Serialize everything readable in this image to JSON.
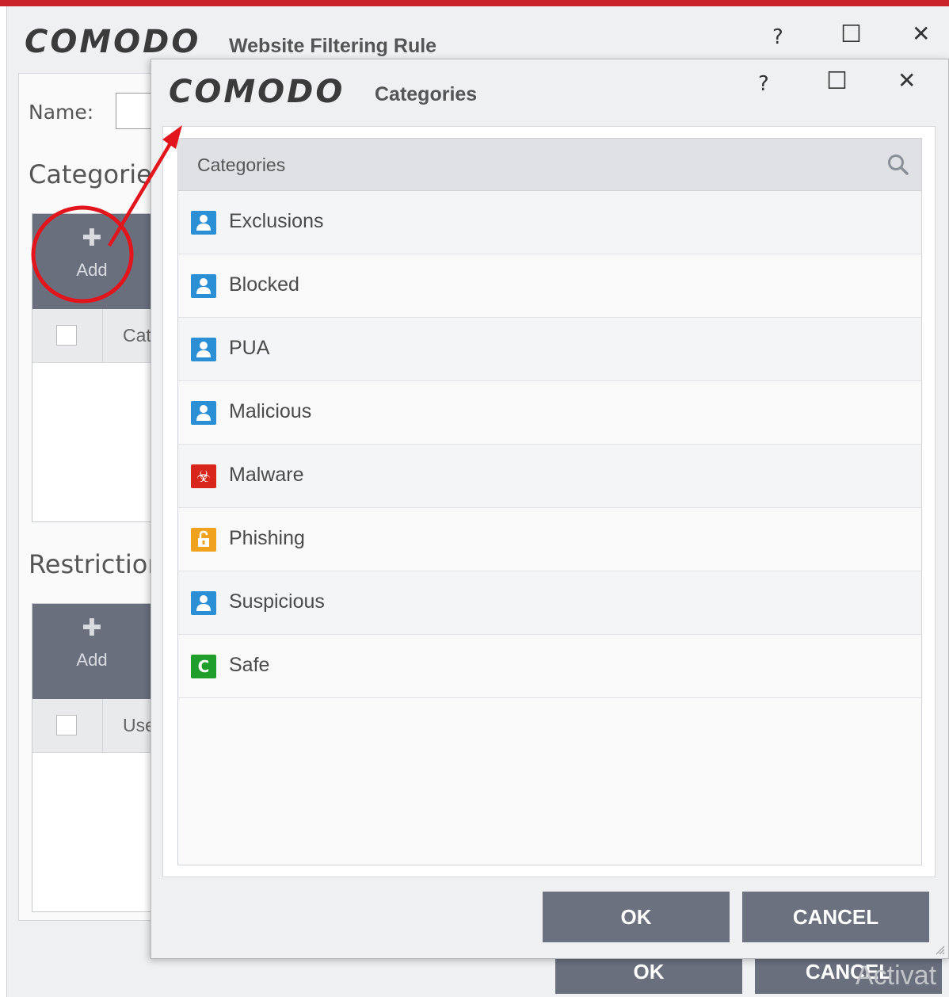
{
  "back_window": {
    "logo": "COMODO",
    "title": "Website Filtering Rule",
    "help": "?",
    "maximize": "☐",
    "close": "✕",
    "name_label": "Name:",
    "categories_heading": "Categories",
    "categories_add": "Add",
    "categories_column": "Cat",
    "restrictions_heading": "Restriction",
    "restrictions_add": "Add",
    "restrictions_column": "Use",
    "ok": "OK",
    "cancel": "CANCEL",
    "watermark": "Activat"
  },
  "dialog": {
    "logo": "COMODO",
    "title": "Categories",
    "help": "?",
    "maximize": "☐",
    "close": "✕",
    "list_header": "Categories",
    "items": [
      {
        "label": "Exclusions",
        "icon": "user-icon",
        "color": "#2b8fd6"
      },
      {
        "label": "Blocked",
        "icon": "user-icon",
        "color": "#2b8fd6"
      },
      {
        "label": "PUA",
        "icon": "user-icon",
        "color": "#2b8fd6"
      },
      {
        "label": "Malicious",
        "icon": "user-icon",
        "color": "#2b8fd6"
      },
      {
        "label": "Malware",
        "icon": "biohazard-icon",
        "color": "#d9261c"
      },
      {
        "label": "Phishing",
        "icon": "lock-icon",
        "color": "#f0a21e"
      },
      {
        "label": "Suspicious",
        "icon": "user-icon",
        "color": "#2b8fd6"
      },
      {
        "label": "Safe",
        "icon": "comodo-c-icon",
        "color": "#1f9e2c"
      }
    ],
    "ok": "OK",
    "cancel": "CANCEL"
  },
  "colors": {
    "accent_red": "#c8242a",
    "button_gray": "#6c717f",
    "annotation_red": "#e2141c"
  }
}
